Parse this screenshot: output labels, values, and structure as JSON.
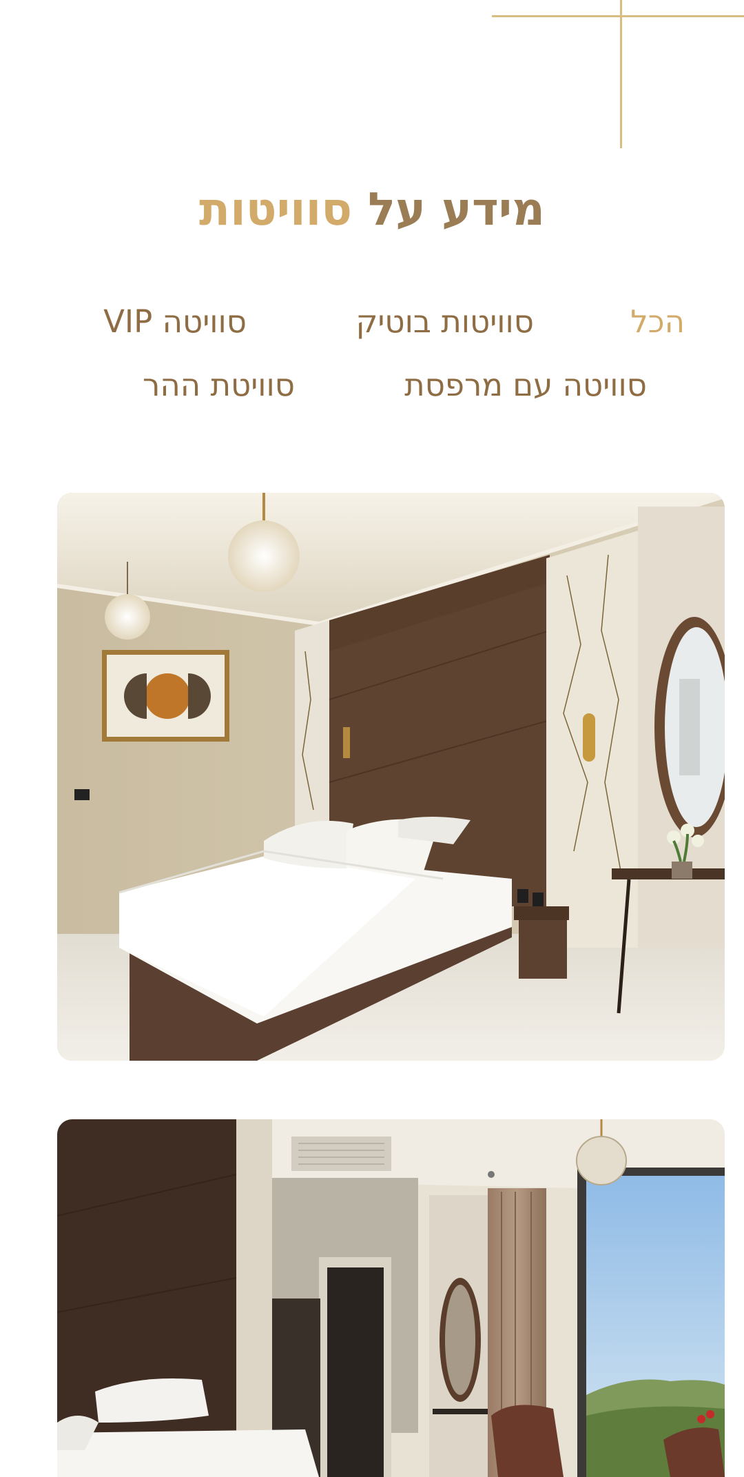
{
  "section": {
    "title_main": "מידע על",
    "title_accent": "סוויטות"
  },
  "filters": {
    "items": [
      {
        "label": "הכל",
        "active": true
      },
      {
        "label": "סוויטות בוטיק",
        "active": false
      },
      {
        "label": "סוויטה VIP",
        "active": false
      },
      {
        "label": "סוויטה עם מרפסת",
        "active": false
      },
      {
        "label": "סוויטת ההר",
        "active": false
      }
    ]
  },
  "gallery": {
    "cards": [
      {
        "image": "suite-bedroom-photo"
      },
      {
        "image": "suite-mountain-view-photo"
      }
    ]
  },
  "colors": {
    "accent_gold": "#d2ab6b",
    "brown_text": "#8f6d44",
    "deco_line": "#d8bc80"
  }
}
